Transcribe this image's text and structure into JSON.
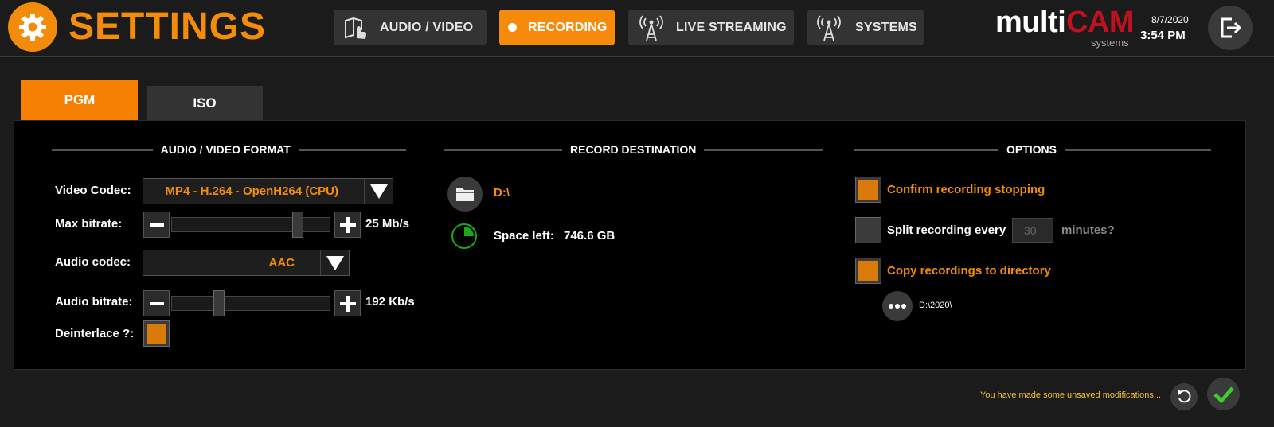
{
  "header": {
    "title": "SETTINGS",
    "nav": [
      {
        "label": "AUDIO / VIDEO",
        "icon": "book-hand-icon"
      },
      {
        "label": "RECORDING",
        "icon": "record-dot-icon",
        "active": true
      },
      {
        "label": "LIVE STREAMING",
        "icon": "antenna-icon"
      },
      {
        "label": "SYSTEMS",
        "icon": "antenna-icon"
      }
    ],
    "brand": {
      "multi": "multi",
      "cam": "CAM",
      "sub": "systems"
    },
    "date": "8/7/2020",
    "time": "3:54 PM"
  },
  "subtabs": {
    "pgm": "PGM",
    "iso": "ISO",
    "active": "PGM"
  },
  "format": {
    "title": "AUDIO / VIDEO FORMAT",
    "video_codec_label": "Video Codec:",
    "video_codec_value": "MP4 - H.264 - OpenH264 (CPU)",
    "max_bitrate_label": "Max bitrate:",
    "max_bitrate_value": "25 Mb/s",
    "max_bitrate_level": 0.82,
    "audio_codec_label": "Audio codec:",
    "audio_codec_value": "AAC",
    "audio_bitrate_label": "Audio bitrate:",
    "audio_bitrate_value": "192 Kb/s",
    "audio_bitrate_level": 0.28,
    "deinterlace_label": "Deinterlace ?:",
    "deinterlace_checked": true
  },
  "destination": {
    "title": "RECORD DESTINATION",
    "path": "D:\\",
    "space_label": "Space left:",
    "space_value": "746.6 GB"
  },
  "options": {
    "title": "OPTIONS",
    "confirm_label": "Confirm recording stopping",
    "confirm_checked": true,
    "split_label": "Split recording every",
    "split_value": "30",
    "split_suffix": "minutes?",
    "split_checked": false,
    "copy_label": "Copy recordings to directory",
    "copy_checked": true,
    "copy_path": "D:\\2020\\"
  },
  "footer": {
    "message": "You have made some unsaved modifications..."
  },
  "colors": {
    "accent": "#f28c0a",
    "brand_red": "#c0121e",
    "ok_green": "#3ecf2a",
    "warning": "#f2c230"
  }
}
